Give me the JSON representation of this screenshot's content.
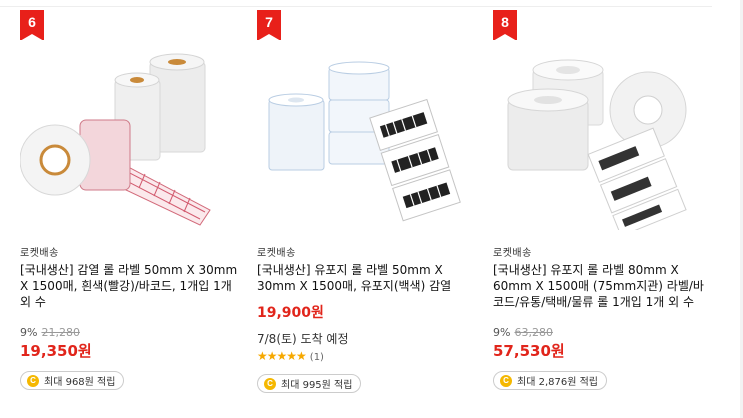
{
  "products": [
    {
      "rank": "6",
      "brand": "로켓배송",
      "title": "[국내생산] 감열 롤 라벨 50mm X 30mm X 1500매, 흰색(빨강)/바코드, 1개입 1개 외 수",
      "discount": "9%",
      "original_price": "21,280",
      "price": "19,350원",
      "reward": "최대 968원 적립",
      "image": "red-striped-label-rolls"
    },
    {
      "rank": "7",
      "brand": "로켓배송",
      "title": "[국내생산] 유포지 롤 라벨 50mm X 30mm X 1500매, 유포지(백색) 감열",
      "price": "19,900원",
      "delivery": "7/8(토) 도착 예정",
      "stars": "★★★★★",
      "review_count": "(1)",
      "reward": "최대 995원 적립",
      "image": "barcode-label-rolls"
    },
    {
      "rank": "8",
      "brand": "로켓배송",
      "title": "[국내생산] 유포지 롤 라벨 80mm X 60mm X 1500매 (75mm지관) 라벨/바코드/유통/택배/물류 롤 1개입 1개 외 수",
      "discount": "9%",
      "original_price": "63,280",
      "price": "57,530원",
      "reward": "최대 2,876원 적립",
      "image": "white-label-rolls"
    }
  ],
  "colors": {
    "rank_badge": "#e8201a",
    "price": "#e1251b",
    "star": "#f6a800",
    "coin": "#f5b800"
  },
  "icons": {
    "reward": "coin-icon",
    "rating": "star-icon"
  }
}
